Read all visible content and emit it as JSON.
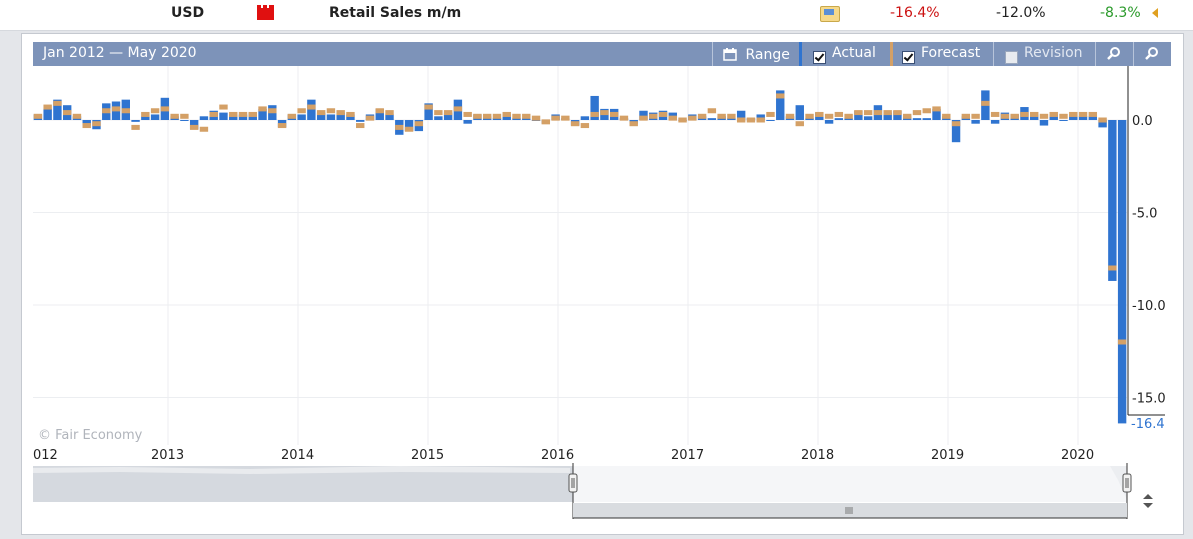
{
  "event_row": {
    "currency": "USD",
    "event_name": "Retail Sales m/m",
    "actual": "-16.4%",
    "forecast": "-12.0%",
    "previous": "-8.3%"
  },
  "toolbar": {
    "range_text": "Jan 2012 — May 2020",
    "range_button": "Range",
    "actual_label": "Actual",
    "forecast_label": "Forecast",
    "revision_label": "Revision",
    "actual_checked": true,
    "forecast_checked": true,
    "revision_checked": false
  },
  "colors": {
    "actual": "#2f74d0",
    "forecast": "#d4a066",
    "toolbar": "#7d93b9"
  },
  "watermark": "© Fair Economy",
  "last_value_label": "-16.4",
  "chart_data": {
    "type": "bar",
    "y_tick_labels": [
      "0.0",
      "-5.0",
      "-10.0",
      "-15.0"
    ],
    "y_ticks": [
      0,
      -5,
      -10,
      -15
    ],
    "ylim": [
      -16.4,
      2.9
    ],
    "x_tick_labels": [
      "012",
      "2013",
      "2014",
      "2015",
      "2016",
      "2017",
      "2018",
      "2019",
      "2020"
    ],
    "x_range": [
      "2012-01",
      "2020-05"
    ],
    "series": [
      {
        "name": "Actual",
        "values": [
          0.3,
          0.6,
          1.1,
          0.8,
          0.2,
          -0.3,
          -0.5,
          0.9,
          1.0,
          1.1,
          -0.1,
          0.2,
          0.3,
          1.2,
          0.2,
          0.0,
          -0.5,
          0.2,
          0.5,
          0.4,
          0.3,
          0.3,
          0.4,
          0.6,
          0.8,
          -0.4,
          0.3,
          0.3,
          1.1,
          0.4,
          0.3,
          0.4,
          0.3,
          -0.1,
          0.3,
          0.6,
          0.3,
          -0.8,
          -0.6,
          -0.6,
          0.9,
          0.2,
          0.4,
          1.1,
          -0.2,
          0.3,
          0.2,
          0.1,
          0.3,
          0.1,
          0.1,
          0.0,
          -0.2,
          0.3,
          0.1,
          -0.3,
          0.2,
          1.3,
          0.6,
          0.6,
          0.1,
          -0.2,
          0.5,
          0.4,
          0.5,
          0.4,
          0.0,
          0.3,
          0.2,
          0.1,
          0.2,
          0.1,
          0.5,
          0.1,
          0.3,
          0.0,
          1.6,
          0.2,
          0.8,
          0.1,
          0.4,
          -0.2,
          0.1,
          0.1,
          0.5,
          0.2,
          0.8,
          0.4,
          0.5,
          0.2,
          0.1,
          0.1,
          0.6,
          0.2,
          -1.2,
          0.2,
          -0.2,
          1.6,
          -0.2,
          0.4,
          0.3,
          0.7,
          0.3,
          -0.3,
          0.3,
          0.0,
          0.3,
          0.2,
          0.2,
          -0.4,
          -8.7,
          -16.4
        ]
      },
      {
        "name": "Forecast",
        "values": [
          0.2,
          0.7,
          0.9,
          0.4,
          0.2,
          -0.3,
          -0.2,
          0.5,
          0.6,
          0.5,
          -0.4,
          0.3,
          0.5,
          0.6,
          0.2,
          0.2,
          -0.4,
          -0.5,
          0.3,
          0.7,
          0.3,
          0.3,
          0.3,
          0.6,
          0.5,
          -0.3,
          0.2,
          0.5,
          0.7,
          0.4,
          0.5,
          0.4,
          0.3,
          -0.3,
          0.1,
          0.5,
          0.4,
          -0.4,
          -0.5,
          -0.2,
          0.7,
          0.4,
          0.4,
          0.6,
          0.3,
          0.2,
          0.2,
          0.2,
          0.3,
          0.2,
          0.2,
          0.1,
          -0.1,
          0.1,
          0.1,
          -0.2,
          -0.3,
          0.3,
          0.4,
          0.3,
          0.1,
          -0.2,
          0.1,
          0.2,
          0.3,
          0.1,
          0.0,
          0.1,
          0.2,
          0.5,
          0.2,
          0.2,
          0.0,
          0.0,
          0.0,
          0.3,
          1.3,
          0.2,
          -0.2,
          0.2,
          0.3,
          0.2,
          0.3,
          0.2,
          0.4,
          0.4,
          0.4,
          0.4,
          0.4,
          0.2,
          0.4,
          0.5,
          0.6,
          0.2,
          -0.2,
          0.2,
          0.2,
          0.9,
          0.3,
          0.2,
          0.2,
          0.3,
          0.3,
          0.2,
          0.3,
          0.2,
          0.3,
          0.3,
          0.3,
          0.0,
          -8.0,
          -12.0
        ]
      }
    ]
  }
}
